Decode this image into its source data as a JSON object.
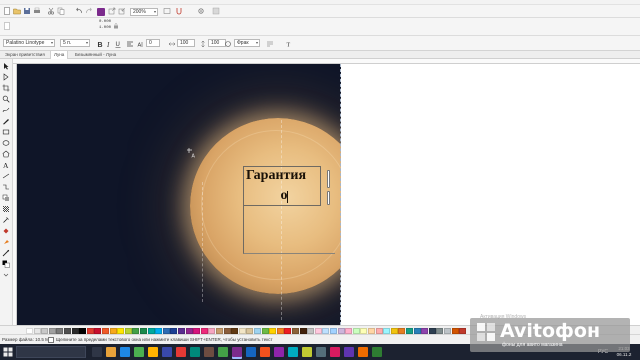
{
  "toolbar_standard": {
    "zoom_level": "200%"
  },
  "toolbar_property1": {
    "pos_x": "0.000",
    "pos_y": "1.000"
  },
  "toolbar_property2": {
    "font_family": "Palatino Linotype",
    "font_size": "5 п.",
    "value_a": "0",
    "value_b": "100",
    "value_c": "100",
    "style_dropdown": "Фрак"
  },
  "tabs": [
    {
      "label": "Экран приветствия"
    },
    {
      "label": "Луна"
    },
    {
      "label": "Безымянный - Луна"
    }
  ],
  "canvas": {
    "text_line1": "Гарантия",
    "text_line2": "о"
  },
  "palette": {
    "colors": [
      "#ffffff",
      "#e6e6e6",
      "#c8c8c8",
      "#a0a0a0",
      "#7a7a7a",
      "#505050",
      "#2a2a2a",
      "#000000",
      "#e03a2f",
      "#c8102e",
      "#f05a28",
      "#f7a81b",
      "#ffe600",
      "#b5d334",
      "#43a047",
      "#1b8a4c",
      "#00a99d",
      "#00aeef",
      "#2e6db4",
      "#1c3f94",
      "#5b2d90",
      "#92278f",
      "#d6157d",
      "#ee2a7b",
      "#f6a6c1",
      "#c69c6d",
      "#8b5e3c",
      "#603913",
      "#f2e5c6",
      "#d8c39b",
      "#9ed3f0",
      "#6dbb45",
      "#ffd200",
      "#f58220",
      "#ed1c24",
      "#8c6239",
      "#42210b",
      "#c1c1c1",
      "#ffc8dd",
      "#bde0fe",
      "#a2d2ff",
      "#cdb4db",
      "#ffafcc",
      "#caffbf",
      "#fdffb6",
      "#ffd6a5",
      "#ffadad",
      "#9bf6ff",
      "#f1c40f",
      "#e67e22",
      "#16a085",
      "#2980b9",
      "#8e44ad",
      "#2c3e50",
      "#7f8c8d",
      "#bdc3c7",
      "#d35400",
      "#c0392b"
    ]
  },
  "statusbar": {
    "file_size": "Размер файла: 10.5 МБ",
    "hint": "Щелкните за пределами текстового окна или нажмите клавиши SHIFT+ENTER, чтобы установить текст"
  },
  "taskbar": {
    "language": "РУС",
    "time": "21:03",
    "date": "06.11.2"
  },
  "overlays": {
    "activate_windows": "Активация Windows",
    "avito_name": "Avitoфон",
    "avito_tagline": "фоны для авито магазина"
  },
  "icons": {
    "zoom_icon": "magnifier-icon",
    "text_cursor_icon": "crosshair-text-icon",
    "start_icon": "windows-icon"
  }
}
